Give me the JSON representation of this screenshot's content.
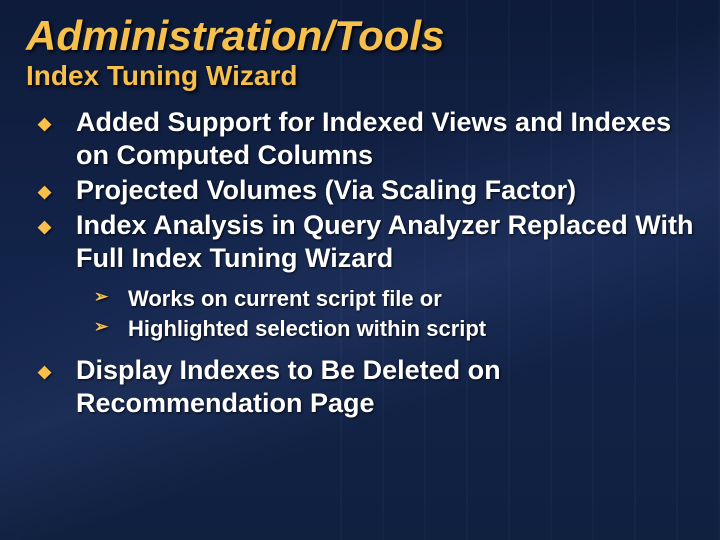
{
  "title": "Administration/Tools",
  "subtitle": "Index Tuning Wizard",
  "bullets": [
    {
      "text": "Added Support for Indexed Views and Indexes on Computed Columns"
    },
    {
      "text": "Projected Volumes (Via Scaling Factor)"
    },
    {
      "text": "Index Analysis in Query Analyzer Replaced With Full Index Tuning Wizard",
      "sub": [
        {
          "text": "Works on current script file or"
        },
        {
          "text": "Highlighted selection within script"
        }
      ]
    },
    {
      "text": "Display Indexes to Be Deleted on Recommendation Page"
    }
  ],
  "glyphs": {
    "diamond": "◆",
    "arrow": "➢"
  }
}
